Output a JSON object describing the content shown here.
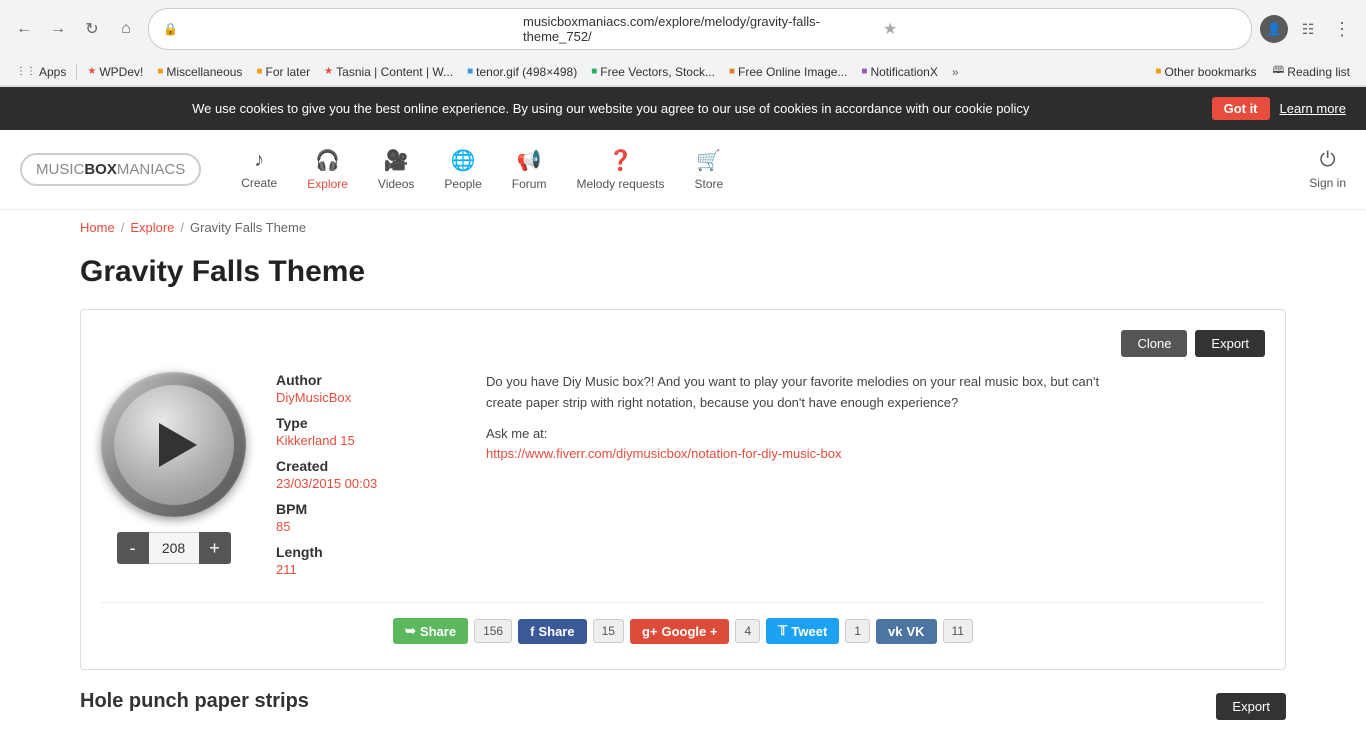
{
  "browser": {
    "url": "musicboxmaniacs.com/explore/melody/gravity-falls-theme_752/",
    "back_btn": "←",
    "forward_btn": "→",
    "refresh_btn": "↻",
    "home_btn": "⌂"
  },
  "bookmarks": {
    "apps_label": "Apps",
    "items": [
      {
        "label": "WPDev!"
      },
      {
        "label": "Miscellaneous"
      },
      {
        "label": "For later"
      },
      {
        "label": "Tasnia | Content | W..."
      },
      {
        "label": "tenor.gif (498×498)"
      },
      {
        "label": "Free Vectors, Stock..."
      },
      {
        "label": "Free Online Image..."
      },
      {
        "label": "NotificationX"
      },
      {
        "label": "»"
      },
      {
        "label": "Other bookmarks"
      },
      {
        "label": "Reading list"
      }
    ]
  },
  "cookie_banner": {
    "text": "We use cookies to give you the best online experience. By using our website you agree to our use of cookies in accordance with our cookie policy",
    "got_it_label": "Got it",
    "learn_more_label": "Learn more"
  },
  "header": {
    "logo": {
      "music": "MUSIC",
      "box": "BOX",
      "maniacs": "MANIACS"
    },
    "nav": [
      {
        "label": "Create",
        "icon": "♪"
      },
      {
        "label": "Explore",
        "icon": "🎧",
        "active": true
      },
      {
        "label": "Videos",
        "icon": "🎬"
      },
      {
        "label": "People",
        "icon": "🌐"
      },
      {
        "label": "Forum",
        "icon": "📢"
      },
      {
        "label": "Melody requests",
        "icon": "❓"
      },
      {
        "label": "Store",
        "icon": "🛒"
      }
    ],
    "signin_label": "Sign in",
    "signin_icon": "⏻"
  },
  "breadcrumb": {
    "home": "Home",
    "explore": "Explore",
    "current": "Gravity Falls Theme"
  },
  "page": {
    "title": "Gravity Falls Theme",
    "card": {
      "clone_label": "Clone",
      "export_label": "Export",
      "author_label": "Author",
      "author_value": "DiyMusicBox",
      "type_label": "Type",
      "type_value": "Kikkerland 15",
      "created_label": "Created",
      "created_value": "23/03/2015 00:03",
      "bpm_label": "BPM",
      "bpm_value": "85",
      "length_label": "Length",
      "length_value": "211",
      "tempo": "208",
      "minus_label": "-",
      "plus_label": "+",
      "description_line1": "Do you have Diy Music box?! And you want to play your favorite melodies on your real music box, but can't",
      "description_line2": "create paper strip with right notation, because you don't have enough experience?",
      "ask_me": "Ask me at:",
      "fiverr_link": "https://www.fiverr.com/diymusicbox/notation-for-diy-music-box"
    },
    "share": {
      "share_label": "Share",
      "share_count": "156",
      "fb_label": "Share",
      "fb_count": "15",
      "gplus_label": "Google +",
      "gplus_count": "4",
      "tw_label": "Tweet",
      "tw_count": "1",
      "vk_label": "VK",
      "vk_count": "11"
    },
    "hole_punch": {
      "title": "Hole punch paper strips",
      "export_label": "Export"
    }
  }
}
